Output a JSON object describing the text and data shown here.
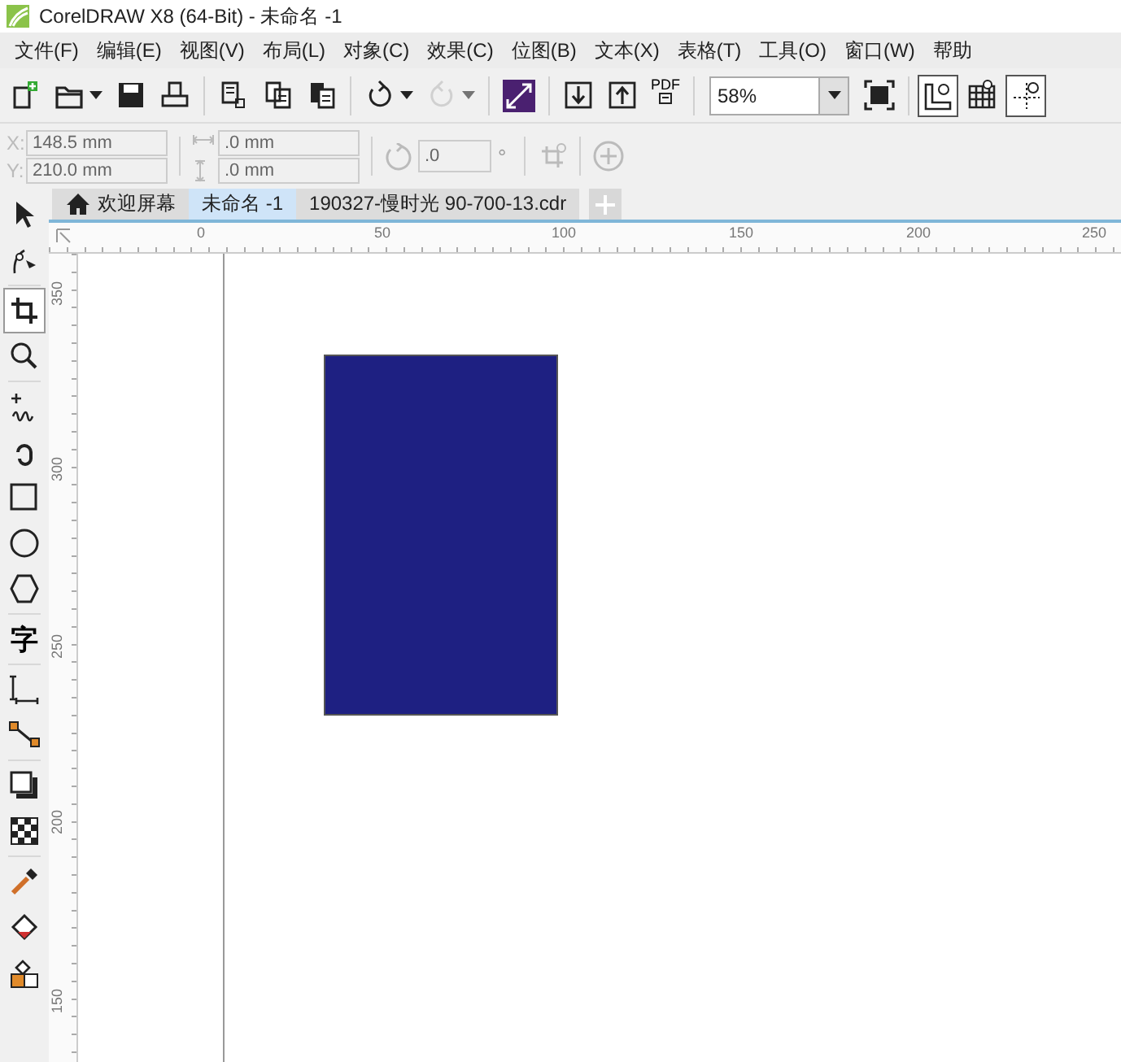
{
  "window": {
    "title": "CorelDRAW X8 (64-Bit) - 未命名 -1"
  },
  "menu": [
    "文件(F)",
    "编辑(E)",
    "视图(V)",
    "布局(L)",
    "对象(C)",
    "效果(C)",
    "位图(B)",
    "文本(X)",
    "表格(T)",
    "工具(O)",
    "窗口(W)",
    "帮助"
  ],
  "standard_toolbar": {
    "pdf_label": "PDF",
    "zoom": "58%",
    "toggles": [
      {
        "kind": "rulers",
        "selected": true
      },
      {
        "kind": "grid",
        "selected": false
      },
      {
        "kind": "guidelines",
        "selected": true
      }
    ]
  },
  "property_bar": {
    "x_label": "X:",
    "x": "148.5 mm",
    "y_label": "Y:",
    "y": "210.0 mm",
    "width": ".0 mm",
    "height": ".0 mm",
    "angle": ".0",
    "degree": "°"
  },
  "tabs": [
    {
      "label": "欢迎屏幕",
      "selected": false,
      "home": true
    },
    {
      "label": "未命名 -1",
      "selected": true
    },
    {
      "label": "190327-慢时光 90-700-13.cdr",
      "selected": false
    }
  ],
  "toolbox": [
    {
      "kind": "pick",
      "selected": false
    },
    {
      "kind": "shape",
      "selected": false
    },
    {
      "kind": "crop",
      "selected": true
    },
    {
      "kind": "zoom",
      "selected": false
    },
    {
      "kind": "freehand",
      "selected": false
    },
    {
      "kind": "artistic",
      "selected": false
    },
    {
      "kind": "rectangle",
      "selected": false
    },
    {
      "kind": "ellipse",
      "selected": false
    },
    {
      "kind": "polygon",
      "selected": false
    },
    {
      "kind": "text",
      "glyph": "字",
      "selected": false
    },
    {
      "kind": "dimension",
      "selected": false
    },
    {
      "kind": "connector",
      "selected": false
    },
    {
      "kind": "shadow",
      "selected": false
    },
    {
      "kind": "transparency",
      "selected": false
    },
    {
      "kind": "eyedropper",
      "selected": false
    },
    {
      "kind": "fill",
      "selected": false
    },
    {
      "kind": "smartfill",
      "selected": false
    }
  ],
  "rulers": {
    "horizontal": [
      "0",
      "50",
      "100",
      "150",
      "200",
      "250"
    ],
    "vertical": [
      "350",
      "300",
      "250",
      "200",
      "150"
    ]
  }
}
